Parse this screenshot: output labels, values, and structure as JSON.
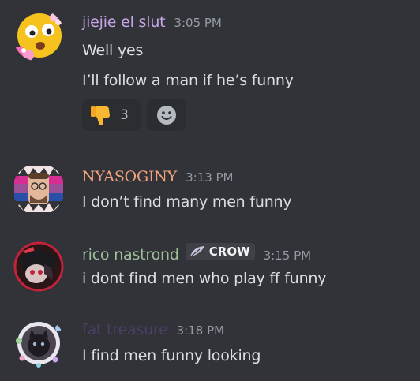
{
  "messages": [
    {
      "username": "jiejie el slut",
      "username_color": "#c9a6e8",
      "timestamp": "3:05 PM",
      "lines": [
        "Well yes",
        "I’ll follow a man if he’s funny"
      ],
      "reaction": {
        "emoji": "thumbs-down-icon",
        "count": "3"
      }
    },
    {
      "username": "NYASOGINY",
      "username_color": "#f0a37a",
      "timestamp": "3:13 PM",
      "lines": [
        "I don’t find many men funny"
      ]
    },
    {
      "username": "rico nastrond",
      "username_color": "#9fbf9a",
      "timestamp": "3:15 PM",
      "tag": "CROW",
      "lines": [
        "i dont find men who play ff funny"
      ]
    },
    {
      "username": "fat treasure",
      "username_color": "#4b3f66",
      "timestamp": "3:18 PM",
      "lines": [
        "I find men funny looking"
      ]
    }
  ]
}
